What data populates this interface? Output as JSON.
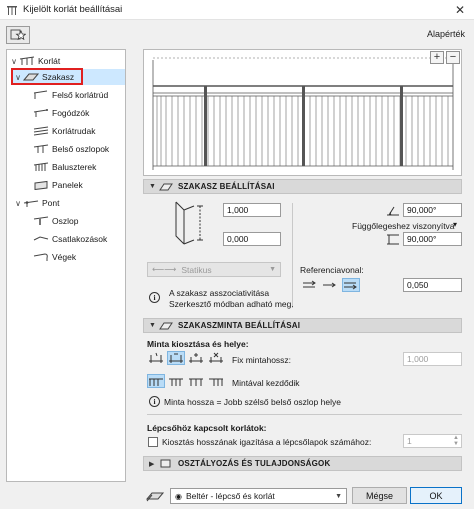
{
  "window": {
    "title": "Kijelölt korlát beállításai",
    "close_glyph": "✕"
  },
  "toolbar": {
    "defaults_label": "Alapérték"
  },
  "tree": {
    "items": [
      {
        "label": "Korlát",
        "chevron": "∨"
      },
      {
        "label": "Szakasz",
        "chevron": "∨"
      },
      {
        "label": "Felső korlátrúd",
        "chevron": ""
      },
      {
        "label": "Fogódzók",
        "chevron": ""
      },
      {
        "label": "Korlátrudak",
        "chevron": ""
      },
      {
        "label": "Belső oszlopok",
        "chevron": ""
      },
      {
        "label": "Baluszterek",
        "chevron": ""
      },
      {
        "label": "Panelek",
        "chevron": ""
      },
      {
        "label": "Pont",
        "chevron": "∨"
      },
      {
        "label": "Oszlop",
        "chevron": ""
      },
      {
        "label": "Csatlakozások",
        "chevron": ""
      },
      {
        "label": "Végek",
        "chevron": ""
      }
    ]
  },
  "preview": {
    "zoom_in": "+",
    "zoom_out": "−"
  },
  "segment_settings": {
    "title": "SZAKASZ BEÁLLÍTÁSAI",
    "height_top": "1,000",
    "height_bottom": "0,000",
    "angle_top": "90,000°",
    "vertical_rel_label": "Függőlegeshez viszonyítva",
    "angle_bottom": "90,000°",
    "statikus_label": "Statikus",
    "info_text_1": "A szakasz asszociativitása",
    "info_text_2": "Szerkesztő módban adható meg.",
    "ref_line_label": "Referenciavonal:",
    "ref_offset": "0,050"
  },
  "pattern_settings": {
    "title": "SZAKASZMINTA BEÁLLÍTÁSAI",
    "distribution_label": "Minta kiosztása és helye:",
    "fixed_length_label": "Fix mintahossz:",
    "fixed_length_value": "1,000",
    "start_label": "Mintával kezdődik",
    "info_text": "Minta hossza = Jobb szélső belső oszlop helye",
    "stair_label": "Lépcsőhöz kapcsolt korlátok:",
    "stair_checkbox_label": "Kiosztás hosszának igazítása a lépcsőlapok számához:",
    "stair_value": "1"
  },
  "classification": {
    "title": "OSZTÁLYOZÁS ÉS TULAJDONSÁGOK"
  },
  "footer": {
    "favorite_label": "Beltér - lépcső és korlát",
    "cancel_label": "Mégse",
    "ok_label": "OK"
  },
  "colors": {
    "accent": "#0a72c8",
    "selection_bg": "#cde8ff",
    "highlight_border": "#e02020"
  }
}
